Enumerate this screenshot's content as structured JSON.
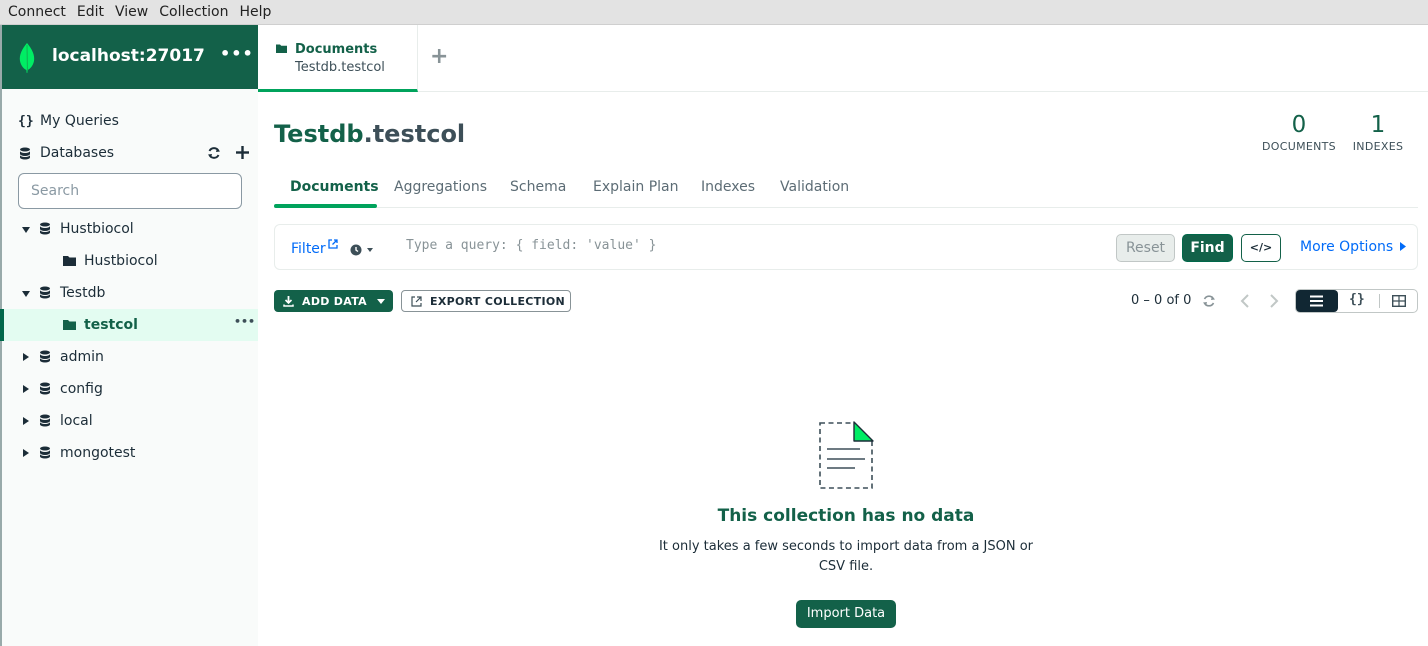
{
  "menubar": [
    "Connect",
    "Edit",
    "View",
    "Collection",
    "Help"
  ],
  "connection": {
    "name": "localhost:27017",
    "more": "•••"
  },
  "sidebar": {
    "my_queries": "My Queries",
    "databases": "Databases",
    "search_placeholder": "Search",
    "tree": [
      {
        "label": "Hustbiocol",
        "type": "database",
        "expanded": true
      },
      {
        "label": "Hustbiocol",
        "type": "collection"
      },
      {
        "label": "Testdb",
        "type": "database",
        "expanded": true
      },
      {
        "label": "testcol",
        "type": "collection",
        "active": true
      },
      {
        "label": "admin",
        "type": "database",
        "expanded": false
      },
      {
        "label": "config",
        "type": "database",
        "expanded": false
      },
      {
        "label": "local",
        "type": "database",
        "expanded": false
      },
      {
        "label": "mongotest",
        "type": "database",
        "expanded": false
      }
    ],
    "row_more": "•••"
  },
  "workspace_tab": {
    "title": "Documents",
    "subtitle": "Testdb.testcol",
    "add": "+"
  },
  "collection": {
    "db": "Testdb",
    "sep": ".",
    "name": "testcol",
    "documents_count": "0",
    "documents_label": "DOCUMENTS",
    "indexes_count": "1",
    "indexes_label": "INDEXES"
  },
  "subtabs": [
    "Documents",
    "Aggregations",
    "Schema",
    "Explain Plan",
    "Indexes",
    "Validation"
  ],
  "querybar": {
    "filter": "Filter",
    "placeholder": "Type a query: { field: 'value' }",
    "reset": "Reset",
    "find": "Find",
    "code": "</>",
    "more_options": "More Options"
  },
  "toolbar": {
    "add_data": "ADD DATA",
    "export": "EXPORT COLLECTION",
    "pager": "0 – 0 of 0"
  },
  "empty_state": {
    "title": "This collection has no data",
    "desc": "It only takes a few seconds to import data from a JSON or CSV file.",
    "button": "Import Data"
  },
  "colors": {
    "brand_dark": "#136149",
    "accent": "#00a35c",
    "link": "#016bf8"
  }
}
